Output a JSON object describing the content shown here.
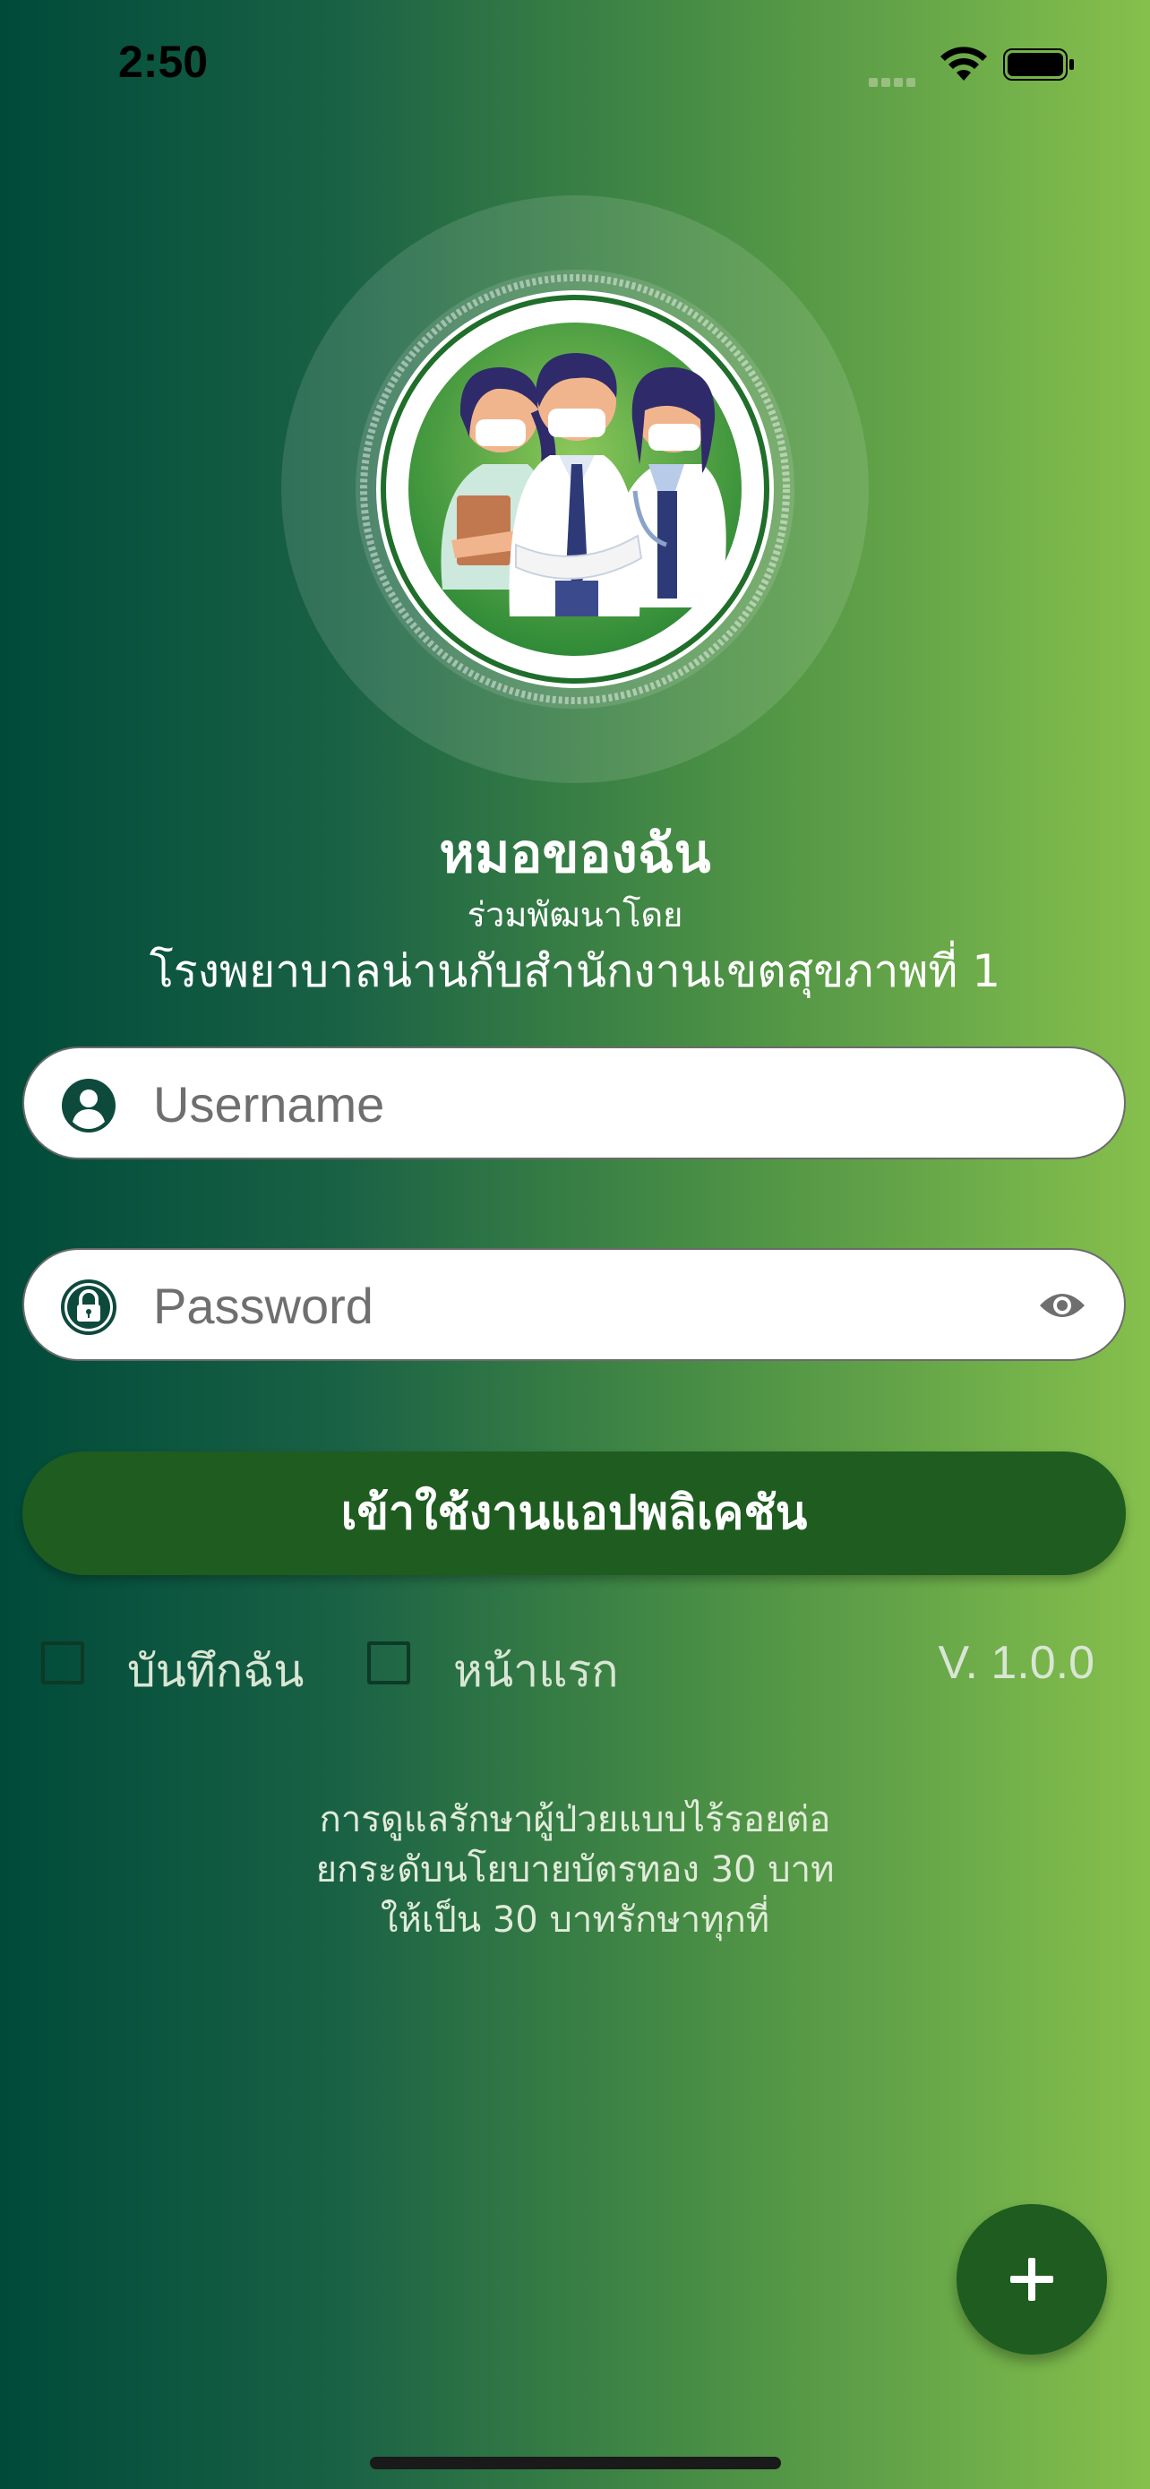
{
  "status_bar": {
    "time": "2:50"
  },
  "header": {
    "app_title": "หมอของฉัน",
    "subtitle": "ร่วมพัฒนาโดย",
    "organization": "โรงพยาบาลน่านกับสำนักงานเขตสุขภาพที่ 1"
  },
  "form": {
    "username_placeholder": "Username",
    "username_value": "",
    "password_placeholder": "Password",
    "password_value": "",
    "login_label": "เข้าใช้งานแอปพลิเคชัน",
    "remember_label": "บันทึกฉัน",
    "home_label": "หน้าแรก",
    "remember_checked": false,
    "home_checked": false,
    "version": "V. 1.0.0"
  },
  "slogan": {
    "line1": "การดูแลรักษาผู้ป่วยแบบไร้รอยต่อ",
    "line2": "ยกระดับนโยบายบัตรทอง 30 บาท",
    "line3": "ให้เป็น 30 บาทรักษาทุกที่"
  },
  "icons": {
    "user": "user-circle-icon",
    "lock": "lock-icon",
    "eye": "eye-icon",
    "add": "plus-icon"
  },
  "colors": {
    "primary_dark": "#1e5c20",
    "icon_teal": "#0d4a3c",
    "gradient_start": "#004a3a",
    "gradient_end": "#86c04c"
  }
}
